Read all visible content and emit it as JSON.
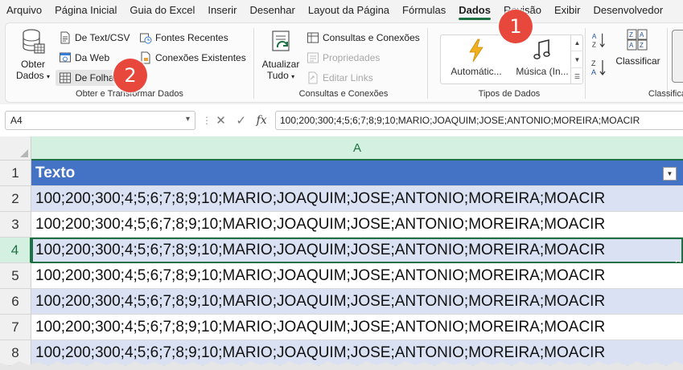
{
  "menu": {
    "items": [
      "Arquivo",
      "Página Inicial",
      "Guia do Excel",
      "Inserir",
      "Desenhar",
      "Layout da Página",
      "Fórmulas",
      "Dados",
      "Revisão",
      "Exibir",
      "Desenvolvedor"
    ],
    "active": "Dados"
  },
  "ribbon": {
    "group1": {
      "label": "Obter e Transformar Dados",
      "big_button": [
        "Obter",
        "Dados"
      ],
      "items": [
        "De Text/CSV",
        "Da Web",
        "De Folha",
        "Fontes Recentes",
        "Conexões Existentes"
      ]
    },
    "group2": {
      "label": "Consultas e Conexões",
      "big_button": [
        "Atualizar",
        "Tudo"
      ],
      "items": [
        "Consultas e Conexões",
        "Propriedades",
        "Editar Links"
      ]
    },
    "group3": {
      "label": "Tipos de Dados",
      "items": [
        "Automátic...",
        "Música (In..."
      ]
    },
    "group4": {
      "label": "Classifica",
      "items": [
        "Classificar"
      ]
    }
  },
  "formula_bar": {
    "name_box": "A4",
    "formula": "100;200;300;4;5;6;7;8;9;10;MARIO;JOAQUIM;JOSE;ANTONIO;MOREIRA;MOACIR"
  },
  "grid": {
    "column": "A",
    "rows": [
      {
        "num": "1",
        "value": "Texto"
      },
      {
        "num": "2",
        "value": "100;200;300;4;5;6;7;8;9;10;MARIO;JOAQUIM;JOSE;ANTONIO;MOREIRA;MOACIR"
      },
      {
        "num": "3",
        "value": "100;200;300;4;5;6;7;8;9;10;MARIO;JOAQUIM;JOSE;ANTONIO;MOREIRA;MOACIR"
      },
      {
        "num": "4",
        "value": "100;200;300;4;5;6;7;8;9;10;MARIO;JOAQUIM;JOSE;ANTONIO;MOREIRA;MOACIR"
      },
      {
        "num": "5",
        "value": "100;200;300;4;5;6;7;8;9;10;MARIO;JOAQUIM;JOSE;ANTONIO;MOREIRA;MOACIR"
      },
      {
        "num": "6",
        "value": "100;200;300;4;5;6;7;8;9;10;MARIO;JOAQUIM;JOSE;ANTONIO;MOREIRA;MOACIR"
      },
      {
        "num": "7",
        "value": "100;200;300;4;5;6;7;8;9;10;MARIO;JOAQUIM;JOSE;ANTONIO;MOREIRA;MOACIR"
      },
      {
        "num": "8",
        "value": "100;200;300;4;5;6;7;8;9;10;MARIO;JOAQUIM;JOSE;ANTONIO;MOREIRA;MOACIR"
      }
    ]
  },
  "badges": [
    "1",
    "2"
  ],
  "colors": {
    "accent_green": "#1e7145",
    "table_header": "#4472c4",
    "table_band": "#d9e1f2",
    "badge_red": "#e8473b"
  },
  "icons": [
    "database-icon",
    "text-csv-icon",
    "web-icon",
    "table-icon",
    "recent-sources-icon",
    "existing-connections-icon",
    "refresh-icon",
    "queries-icon",
    "properties-icon",
    "edit-links-icon",
    "lightning-icon",
    "music-note-icon",
    "sort-az-icon",
    "sort-za-icon",
    "sort-icon",
    "cancel-icon",
    "enter-icon",
    "fx-icon",
    "filter-dropdown-icon"
  ]
}
